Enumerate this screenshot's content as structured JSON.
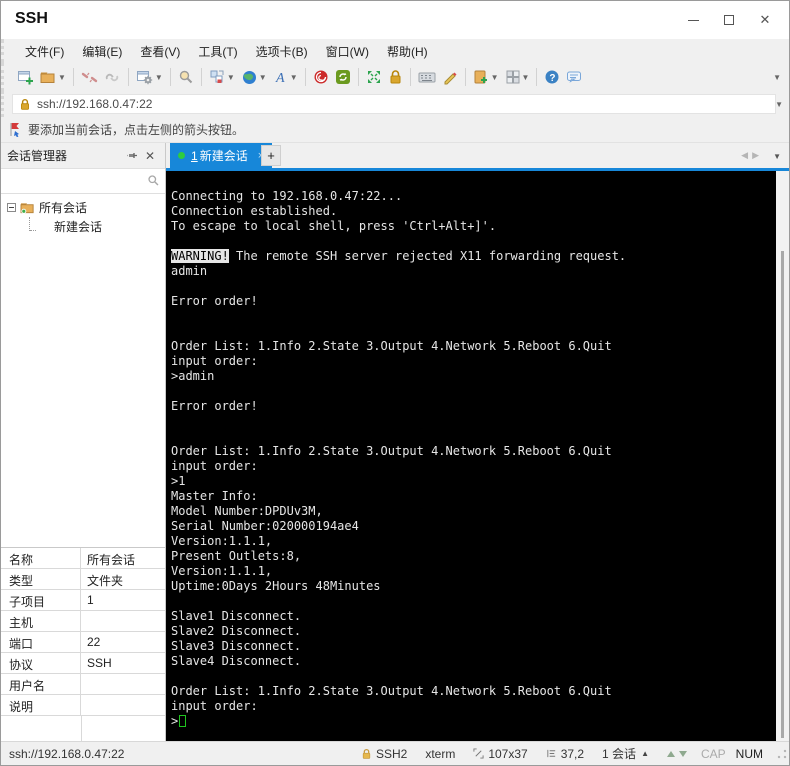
{
  "window": {
    "title": "SSH"
  },
  "menu": {
    "items": [
      "文件(F)",
      "编辑(E)",
      "查看(V)",
      "工具(T)",
      "选项卡(B)",
      "窗口(W)",
      "帮助(H)"
    ]
  },
  "toolbar": {
    "icons": [
      "new-session-icon",
      "open-folder-icon",
      "disconnect-icon",
      "reconnect-icon",
      "session-properties-icon",
      "find-icon",
      "duplicate-session-icon",
      "encoding-globe-icon",
      "font-icon",
      "swirl-icon",
      "sync-icon",
      "fullscreen-icon",
      "lock-icon",
      "virtual-keyboard-icon",
      "compose-pen-icon",
      "new-file-icon",
      "layout-grid-icon",
      "help-icon",
      "feedback-chat-icon"
    ]
  },
  "address_bar": {
    "value": "ssh://192.168.0.47:22"
  },
  "notice_bar": {
    "text": "要添加当前会话，点击左侧的箭头按钮。"
  },
  "session_panel": {
    "title": "会话管理器",
    "search_placeholder": "",
    "tree": {
      "root": "所有会话",
      "child": "新建会话"
    }
  },
  "tab_bar": {
    "tabs": [
      {
        "number": "1",
        "label": "新建会话",
        "close": "×",
        "active": true
      }
    ],
    "new_tab": "+"
  },
  "terminal": {
    "invert_token": "WARNING!",
    "prompt": ">",
    "lines": [
      "Connecting to 192.168.0.47:22...",
      "Connection established.",
      "To escape to local shell, press 'Ctrl+Alt+]'.",
      "",
      "WARNING! The remote SSH server rejected X11 forwarding request.",
      "admin",
      "",
      "Error order!",
      "",
      "",
      "Order List: 1.Info 2.State 3.Output 4.Network 5.Reboot 6.Quit",
      "input order:",
      ">admin",
      "",
      "Error order!",
      "",
      "",
      "Order List: 1.Info 2.State 3.Output 4.Network 5.Reboot 6.Quit",
      "input order:",
      ">1",
      "Master Info:",
      "Model Number:DPDUv3M,",
      "Serial Number:020000194ae4",
      "Version:1.1.1,",
      "Present Outlets:8,",
      "Version:1.1.1,",
      "Uptime:0Days 2Hours 48Minutes",
      "",
      "Slave1 Disconnect.",
      "Slave2 Disconnect.",
      "Slave3 Disconnect.",
      "Slave4 Disconnect.",
      "",
      "Order List: 1.Info 2.State 3.Output 4.Network 5.Reboot 6.Quit",
      "input order:"
    ]
  },
  "properties": {
    "rows": [
      {
        "label": "名称",
        "value": "所有会话"
      },
      {
        "label": "类型",
        "value": "文件夹"
      },
      {
        "label": "子项目",
        "value": "1"
      },
      {
        "label": "主机",
        "value": ""
      },
      {
        "label": "端口",
        "value": "22"
      },
      {
        "label": "协议",
        "value": "SSH"
      },
      {
        "label": "用户名",
        "value": ""
      },
      {
        "label": "说明",
        "value": ""
      }
    ]
  },
  "status_bar": {
    "left": "ssh://192.168.0.47:22",
    "protocol": "SSH2",
    "terminal_type": "xterm",
    "size": "107x37",
    "cursor_pos": "37,2",
    "session_count": "1 会话",
    "cap": "CAP",
    "num": "NUM"
  },
  "colors": {
    "accent_blue": "#1787d9",
    "terminal_bg": "#000000",
    "terminal_fg": "#e6e6e6",
    "cursor_green": "#1fc41f",
    "lock_gold": "#d9a62e"
  }
}
